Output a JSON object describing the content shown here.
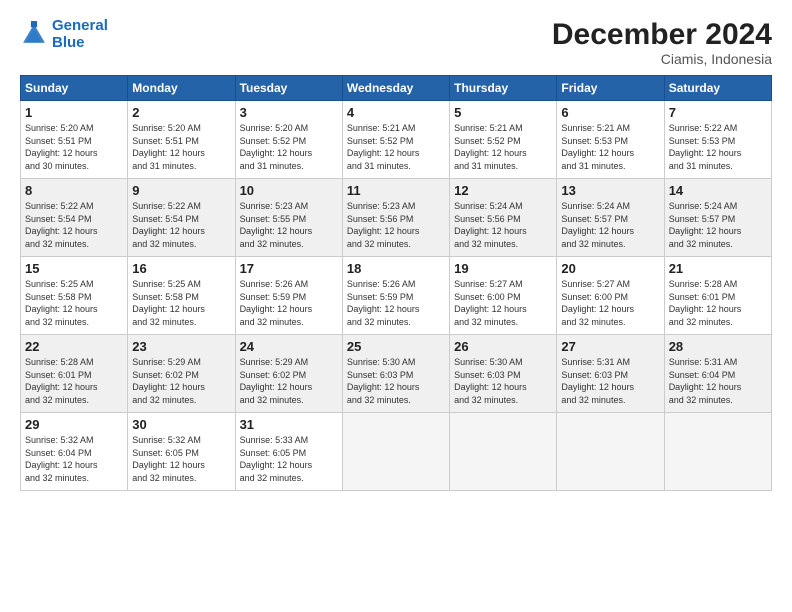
{
  "logo": {
    "line1": "General",
    "line2": "Blue"
  },
  "title": "December 2024",
  "location": "Ciamis, Indonesia",
  "days_header": [
    "Sunday",
    "Monday",
    "Tuesday",
    "Wednesday",
    "Thursday",
    "Friday",
    "Saturday"
  ],
  "weeks": [
    [
      {
        "day": "1",
        "info": "Sunrise: 5:20 AM\nSunset: 5:51 PM\nDaylight: 12 hours\nand 30 minutes."
      },
      {
        "day": "2",
        "info": "Sunrise: 5:20 AM\nSunset: 5:51 PM\nDaylight: 12 hours\nand 31 minutes."
      },
      {
        "day": "3",
        "info": "Sunrise: 5:20 AM\nSunset: 5:52 PM\nDaylight: 12 hours\nand 31 minutes."
      },
      {
        "day": "4",
        "info": "Sunrise: 5:21 AM\nSunset: 5:52 PM\nDaylight: 12 hours\nand 31 minutes."
      },
      {
        "day": "5",
        "info": "Sunrise: 5:21 AM\nSunset: 5:52 PM\nDaylight: 12 hours\nand 31 minutes."
      },
      {
        "day": "6",
        "info": "Sunrise: 5:21 AM\nSunset: 5:53 PM\nDaylight: 12 hours\nand 31 minutes."
      },
      {
        "day": "7",
        "info": "Sunrise: 5:22 AM\nSunset: 5:53 PM\nDaylight: 12 hours\nand 31 minutes."
      }
    ],
    [
      {
        "day": "8",
        "info": "Sunrise: 5:22 AM\nSunset: 5:54 PM\nDaylight: 12 hours\nand 32 minutes."
      },
      {
        "day": "9",
        "info": "Sunrise: 5:22 AM\nSunset: 5:54 PM\nDaylight: 12 hours\nand 32 minutes."
      },
      {
        "day": "10",
        "info": "Sunrise: 5:23 AM\nSunset: 5:55 PM\nDaylight: 12 hours\nand 32 minutes."
      },
      {
        "day": "11",
        "info": "Sunrise: 5:23 AM\nSunset: 5:56 PM\nDaylight: 12 hours\nand 32 minutes."
      },
      {
        "day": "12",
        "info": "Sunrise: 5:24 AM\nSunset: 5:56 PM\nDaylight: 12 hours\nand 32 minutes."
      },
      {
        "day": "13",
        "info": "Sunrise: 5:24 AM\nSunset: 5:57 PM\nDaylight: 12 hours\nand 32 minutes."
      },
      {
        "day": "14",
        "info": "Sunrise: 5:24 AM\nSunset: 5:57 PM\nDaylight: 12 hours\nand 32 minutes."
      }
    ],
    [
      {
        "day": "15",
        "info": "Sunrise: 5:25 AM\nSunset: 5:58 PM\nDaylight: 12 hours\nand 32 minutes."
      },
      {
        "day": "16",
        "info": "Sunrise: 5:25 AM\nSunset: 5:58 PM\nDaylight: 12 hours\nand 32 minutes."
      },
      {
        "day": "17",
        "info": "Sunrise: 5:26 AM\nSunset: 5:59 PM\nDaylight: 12 hours\nand 32 minutes."
      },
      {
        "day": "18",
        "info": "Sunrise: 5:26 AM\nSunset: 5:59 PM\nDaylight: 12 hours\nand 32 minutes."
      },
      {
        "day": "19",
        "info": "Sunrise: 5:27 AM\nSunset: 6:00 PM\nDaylight: 12 hours\nand 32 minutes."
      },
      {
        "day": "20",
        "info": "Sunrise: 5:27 AM\nSunset: 6:00 PM\nDaylight: 12 hours\nand 32 minutes."
      },
      {
        "day": "21",
        "info": "Sunrise: 5:28 AM\nSunset: 6:01 PM\nDaylight: 12 hours\nand 32 minutes."
      }
    ],
    [
      {
        "day": "22",
        "info": "Sunrise: 5:28 AM\nSunset: 6:01 PM\nDaylight: 12 hours\nand 32 minutes."
      },
      {
        "day": "23",
        "info": "Sunrise: 5:29 AM\nSunset: 6:02 PM\nDaylight: 12 hours\nand 32 minutes."
      },
      {
        "day": "24",
        "info": "Sunrise: 5:29 AM\nSunset: 6:02 PM\nDaylight: 12 hours\nand 32 minutes."
      },
      {
        "day": "25",
        "info": "Sunrise: 5:30 AM\nSunset: 6:03 PM\nDaylight: 12 hours\nand 32 minutes."
      },
      {
        "day": "26",
        "info": "Sunrise: 5:30 AM\nSunset: 6:03 PM\nDaylight: 12 hours\nand 32 minutes."
      },
      {
        "day": "27",
        "info": "Sunrise: 5:31 AM\nSunset: 6:03 PM\nDaylight: 12 hours\nand 32 minutes."
      },
      {
        "day": "28",
        "info": "Sunrise: 5:31 AM\nSunset: 6:04 PM\nDaylight: 12 hours\nand 32 minutes."
      }
    ],
    [
      {
        "day": "29",
        "info": "Sunrise: 5:32 AM\nSunset: 6:04 PM\nDaylight: 12 hours\nand 32 minutes."
      },
      {
        "day": "30",
        "info": "Sunrise: 5:32 AM\nSunset: 6:05 PM\nDaylight: 12 hours\nand 32 minutes."
      },
      {
        "day": "31",
        "info": "Sunrise: 5:33 AM\nSunset: 6:05 PM\nDaylight: 12 hours\nand 32 minutes."
      },
      null,
      null,
      null,
      null
    ]
  ]
}
